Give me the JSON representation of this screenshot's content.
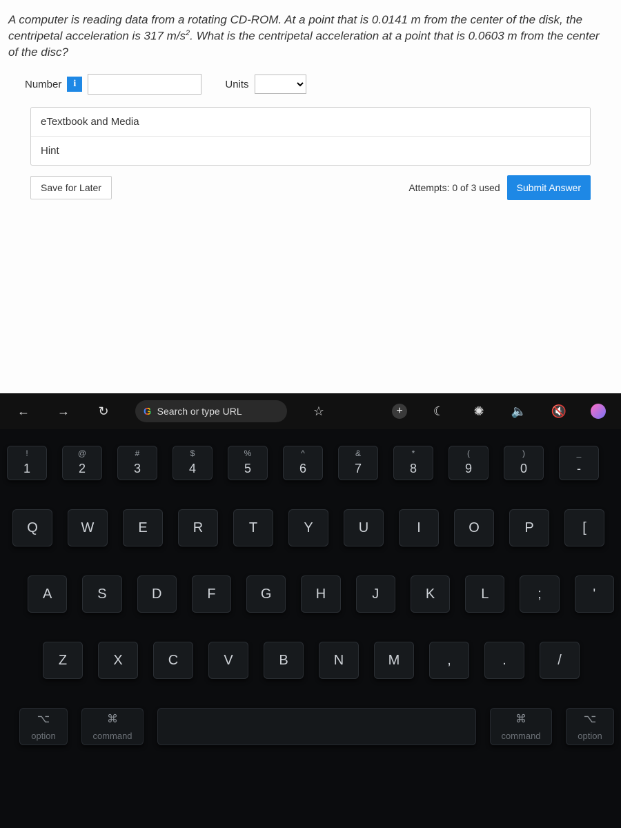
{
  "question": {
    "text_a": "A computer is reading data from a rotating CD-ROM. At a point that is 0.0141 m from the center of the disk, the centripetal",
    "text_b": "acceleration is 317 m/s",
    "sup": "2",
    "text_c": ". What is the centripetal acceleration at a point that is 0.0603 m from the center of the disc?"
  },
  "answer": {
    "number_label": "Number",
    "info_glyph": "i",
    "units_label": "Units",
    "number_value": "",
    "units_value": ""
  },
  "resources": {
    "etextbook": "eTextbook and Media",
    "hint": "Hint"
  },
  "actions": {
    "save": "Save for Later",
    "attempts": "Attempts: 0 of 3 used",
    "submit": "Submit Answer"
  },
  "chrome": {
    "back": "←",
    "forward": "→",
    "reload": "↻",
    "g": "G",
    "omnibox_placeholder": "Search or type URL",
    "star": "☆",
    "plus": "+",
    "moon": "☾",
    "bright": "✺",
    "sound": "🔈",
    "mute": "🔇"
  },
  "kb": {
    "row_num": [
      {
        "u": "!",
        "l": "1"
      },
      {
        "u": "@",
        "l": "2"
      },
      {
        "u": "#",
        "l": "3"
      },
      {
        "u": "$",
        "l": "4"
      },
      {
        "u": "%",
        "l": "5"
      },
      {
        "u": "^",
        "l": "6"
      },
      {
        "u": "&",
        "l": "7"
      },
      {
        "u": "*",
        "l": "8"
      },
      {
        "u": "(",
        "l": "9"
      },
      {
        "u": ")",
        "l": "0"
      },
      {
        "u": "_",
        "l": "-"
      }
    ],
    "row_q": [
      "Q",
      "W",
      "E",
      "R",
      "T",
      "Y",
      "U",
      "I",
      "O",
      "P",
      "["
    ],
    "row_a": [
      "A",
      "S",
      "D",
      "F",
      "G",
      "H",
      "J",
      "K",
      "L",
      ";",
      "'"
    ],
    "row_z": [
      "Z",
      "X",
      "C",
      "V",
      "B",
      "N",
      "M",
      ",",
      ".",
      "/"
    ],
    "mods": {
      "opt_sym": "⌥",
      "opt": "option",
      "cmd_sym": "⌘",
      "cmd": "command",
      "cmd_sym2": "⌘",
      "cmd2": "command",
      "opt_sym2": "⌥",
      "opt2": "option"
    }
  }
}
